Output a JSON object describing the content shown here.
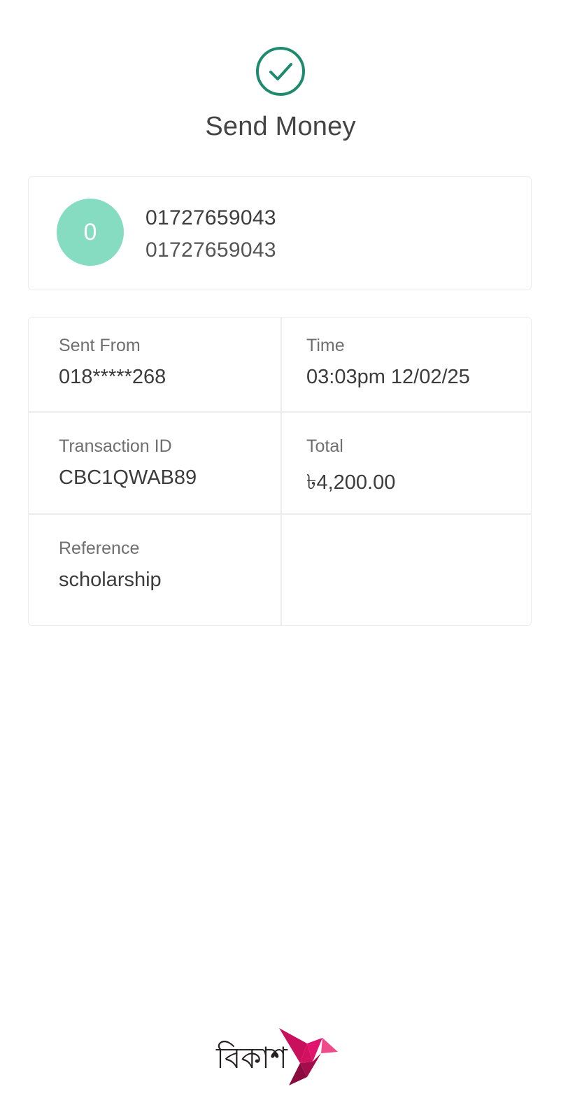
{
  "header": {
    "title": "Send Money"
  },
  "recipient": {
    "avatar_initial": "0",
    "name": "01727659043",
    "number": "01727659043"
  },
  "details": {
    "sent_from": {
      "label": "Sent From",
      "value": "018*****268"
    },
    "time": {
      "label": "Time",
      "value": "03:03pm 12/02/25"
    },
    "transaction_id": {
      "label": "Transaction ID",
      "value": "CBC1QWAB89"
    },
    "total": {
      "label": "Total",
      "value": "৳4,200.00"
    },
    "reference": {
      "label": "Reference",
      "value": "scholarship"
    }
  },
  "brand": {
    "logo_text": "বিকাশ",
    "accent_color": "#e2136e",
    "success_color": "#1e8a6e",
    "avatar_color": "#86dcc0"
  }
}
